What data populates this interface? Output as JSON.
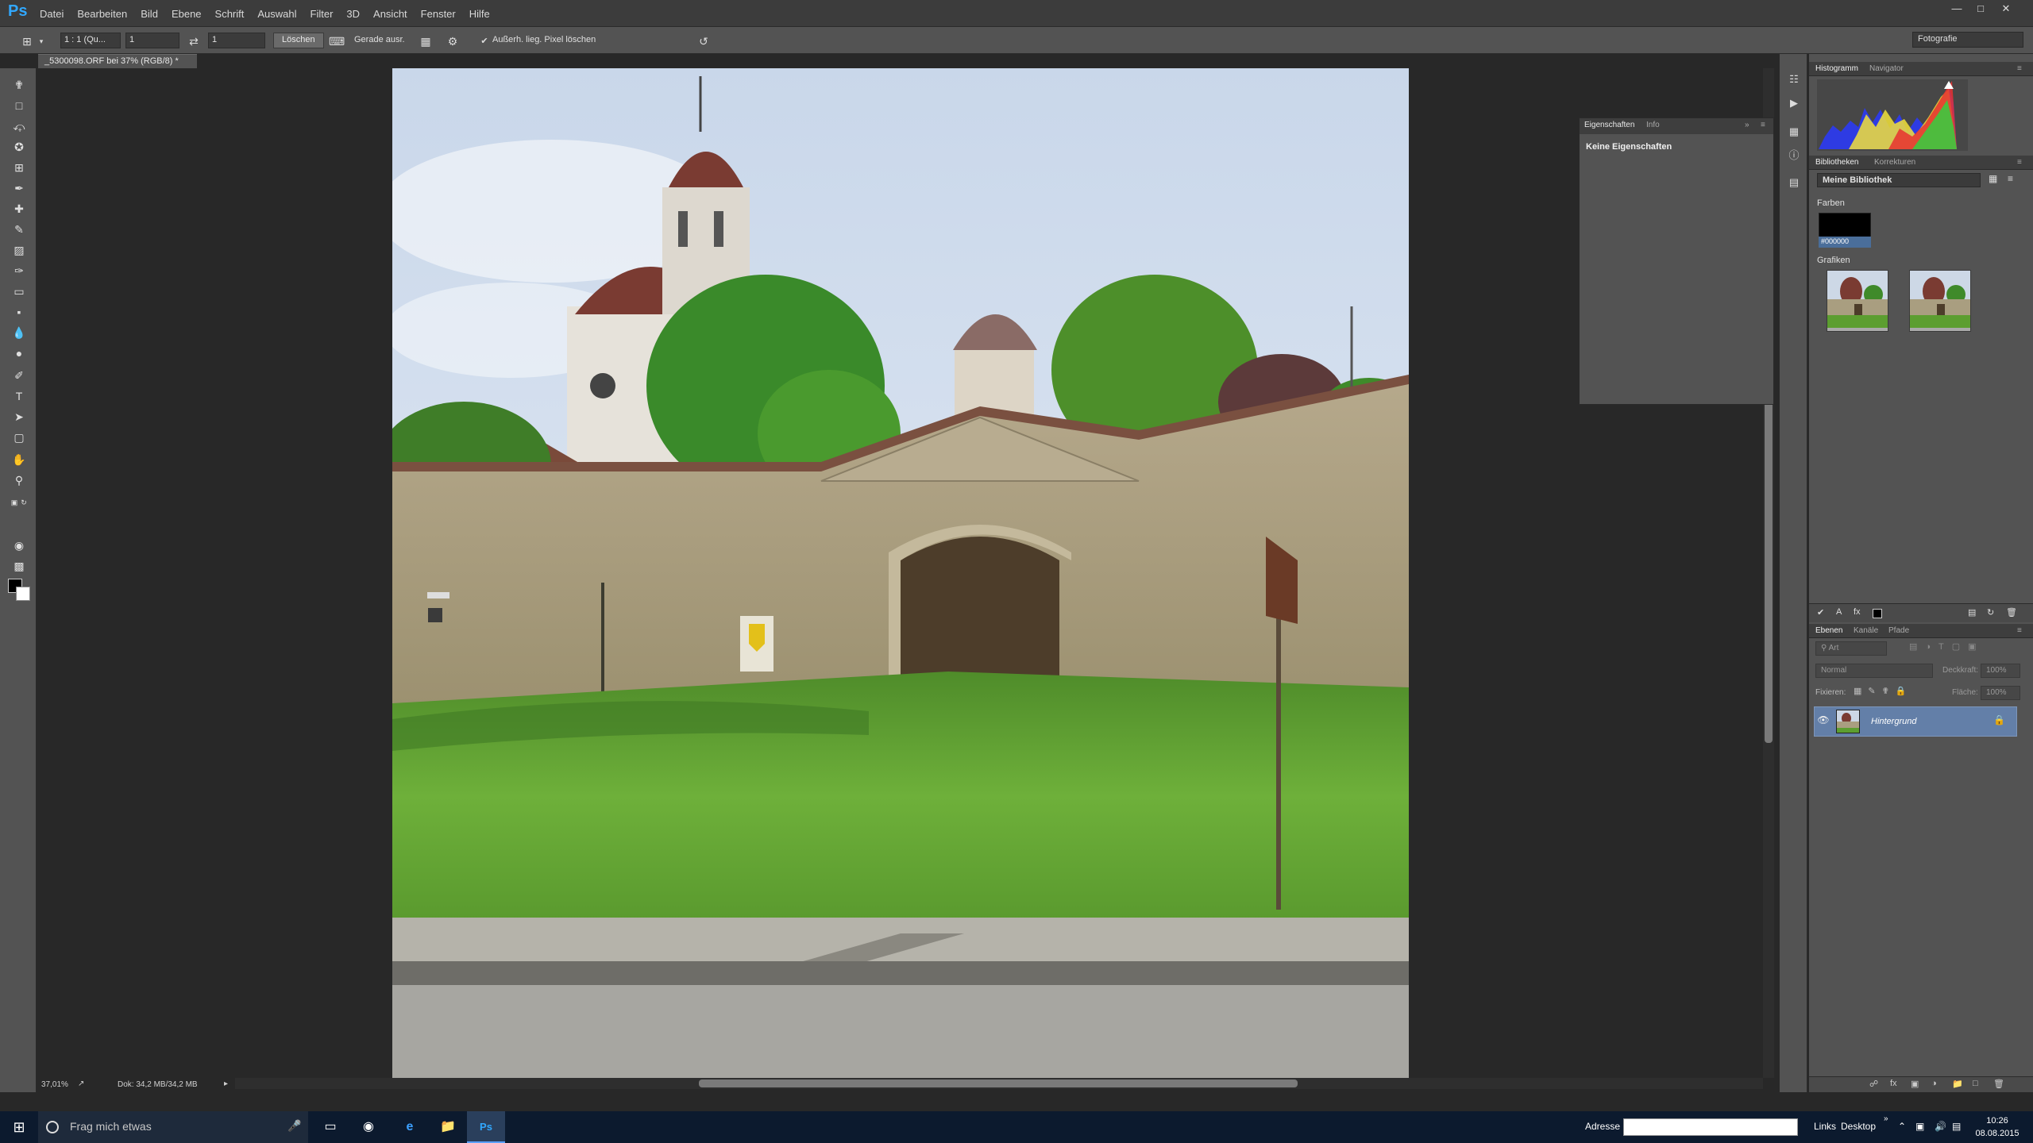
{
  "app": {
    "logo": "Ps"
  },
  "menu": [
    "Datei",
    "Bearbeiten",
    "Bild",
    "Ebene",
    "Schrift",
    "Auswahl",
    "Filter",
    "3D",
    "Ansicht",
    "Fenster",
    "Hilfe"
  ],
  "options": {
    "ratio": "1 : 1 (Qu...",
    "width": "1",
    "height": "1",
    "clear_button": "Löschen",
    "straighten_label": "Gerade ausr.",
    "delete_pixels_label": "Außerh. lieg. Pixel löschen",
    "workspace": "Fotografie"
  },
  "document": {
    "tab_title": "_5300098.ORF bei 37% (RGB/8) *"
  },
  "status": {
    "zoom": "37,01%",
    "doc_size": "Dok: 34,2 MB/34,2 MB"
  },
  "properties_panel": {
    "tabs": [
      "Eigenschaften",
      "Info"
    ],
    "body": "Keine Eigenschaften"
  },
  "histogram_panel": {
    "tabs": [
      "Histogramm",
      "Navigator"
    ]
  },
  "libraries_panel": {
    "tabs": [
      "Bibliotheken",
      "Korrekturen"
    ],
    "library": "Meine Bibliothek",
    "colors_heading": "Farben",
    "color_hex": "#000000",
    "graphics_heading": "Grafiken"
  },
  "layers_panel": {
    "tabs": [
      "Ebenen",
      "Kanäle",
      "Pfade"
    ],
    "filter": "Art",
    "blend_mode": "Normal",
    "opacity_label": "Deckkraft:",
    "opacity_value": "100%",
    "lock_label": "Fixieren:",
    "fill_label": "Fläche:",
    "fill_value": "100%",
    "layer_name": "Hintergrund"
  },
  "taskbar": {
    "search_placeholder": "Frag mich etwas",
    "address_label": "Adresse",
    "links_label": "Links",
    "desktop_label": "Desktop",
    "time": "10:26",
    "date": "08.08.2015"
  },
  "colors": {
    "accent": "#31a8ff",
    "panel": "#535353",
    "layer_selected": "#637fa8"
  }
}
